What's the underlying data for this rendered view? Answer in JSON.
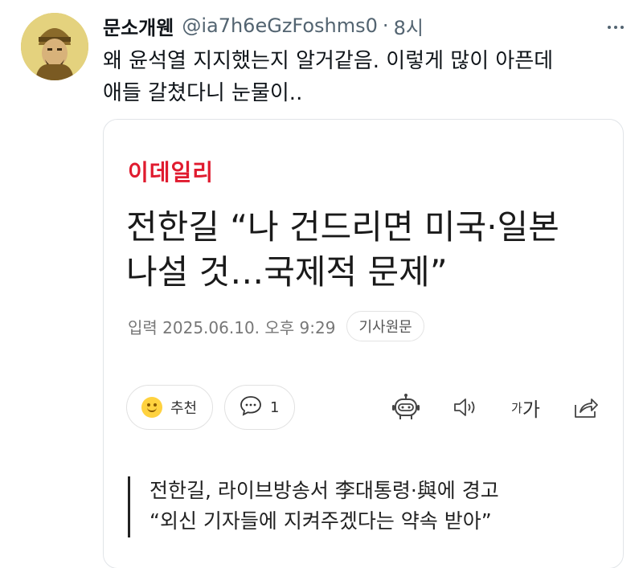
{
  "tweet": {
    "author_name": "문소개웬",
    "handle": "@ia7h6eGzFoshms0",
    "separator": "·",
    "time": "8시",
    "text_lines": [
      "왜 윤석열 지지했는지 알거같음. 이렇게 많이 아픈데",
      "애들 갈쳤다니 눈물이.."
    ]
  },
  "article_card": {
    "press_name": "이데일리",
    "headline_lines": [
      "전한길 “나 건드리면 미국·일본",
      "나설 것…국제적 문제”"
    ],
    "date": "입력 2025.06.10. 오후 9:29",
    "original_button": "기사원문",
    "recommend_label": "추천",
    "comment_count": "1",
    "font_size_label_small": "가",
    "font_size_label_large": "가",
    "quote_lines": [
      "전한길, 라이브방송서 李대통령·與에 경고",
      "“외신 기자들에 지켜주겠다는 약속 받아”"
    ]
  },
  "icons": [
    "avatar",
    "more-icon",
    "smile-icon",
    "comment-icon",
    "robot-icon",
    "speaker-icon",
    "font-size-icon",
    "share-icon"
  ]
}
